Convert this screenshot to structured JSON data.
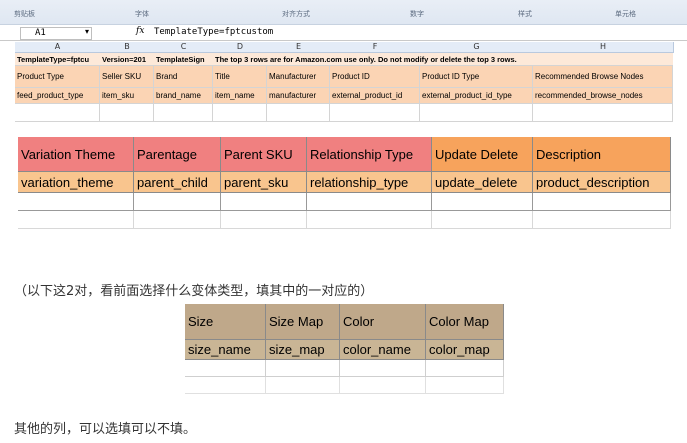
{
  "ribbon": {
    "labels": [
      "剪贴板",
      "字体",
      "对齐方式",
      "数字",
      "样式",
      "单元格"
    ]
  },
  "formula_bar": {
    "cell_ref": "A1",
    "dropdown_icon": "chevron-down-icon",
    "fx_label": "fx",
    "formula": "TemplateType=fptcustom"
  },
  "sheet": {
    "columns": [
      "A",
      "B",
      "C",
      "D",
      "E",
      "F",
      "G",
      "H"
    ],
    "row1": [
      "TemplateType=fptcu",
      "Version=201",
      "TemplateSign",
      "The top 3 rows are for Amazon.com use only. Do not modify or delete the top 3 rows."
    ],
    "row2": [
      "Product Type",
      "Seller SKU",
      "Brand",
      "Title",
      "Manufacturer",
      "Product ID",
      "Product ID Type",
      "Recommended Browse Nodes"
    ],
    "row3": [
      "feed_product_type",
      "item_sku",
      "brand_name",
      "item_name",
      "manufacturer",
      "external_product_id",
      "external_product_id_type",
      "recommended_browse_nodes"
    ]
  },
  "variation_table": {
    "headers": [
      "Variation Theme",
      "Parentage",
      "Parent SKU",
      "Relationship Type",
      "Update Delete",
      "Description"
    ],
    "values": [
      "variation_theme",
      "parent_child",
      "parent_sku",
      "relationship_type",
      "update_delete",
      "product_description"
    ]
  },
  "note_pairs": "（以下这2对，看前面选择什么变体类型，填其中的一对应的）",
  "size_color_table": {
    "headers": [
      "Size",
      "Size Map",
      "Color",
      "Color Map"
    ],
    "values": [
      "size_name",
      "size_map",
      "color_name",
      "color_map"
    ]
  },
  "note_others": "其他的列，可以选填可以不填。",
  "colors": {
    "variation_header": "#f08080",
    "variation_header_alt": "#f7a35c",
    "variation_value": "#f9c58e",
    "size_header": "#bfa88a",
    "size_value": "#c9b595",
    "sheet_header": "#fbd4b4"
  }
}
